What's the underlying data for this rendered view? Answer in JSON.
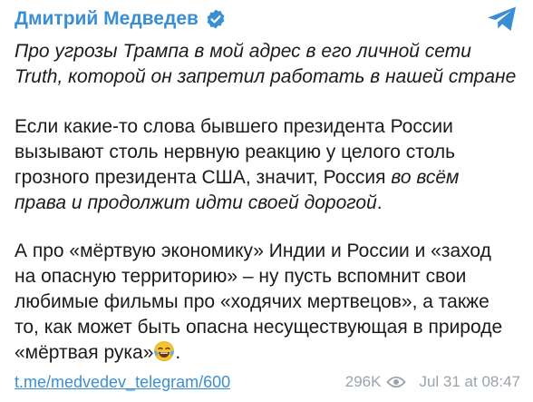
{
  "channel": {
    "name": "Дмитрий Медведев",
    "verified_icon": "verified-badge-icon",
    "app_logo_icon": "telegram-plane-icon"
  },
  "post": {
    "intro_italic": "Про угрозы Трампа в мой адрес в его личной сети Truth, которой он запретил работать в нашей стране",
    "para2_line1": "Если какие-то слова бывшего президента России",
    "para2_line2": "вызывают столь нервную реакцию у целого столь",
    "para2_line3_plain": "грозного президента США, значит, Россия ",
    "para2_line3_italic": "во всём",
    "para2_line4_italic": "права и продолжит идти своей дорогой",
    "para2_line4_end": ".",
    "para3_line1": "А про «мёртвую экономику» Индии и России и «заход",
    "para3_line2": "на опасную территорию» – ну пусть вспомнит свои",
    "para3_line3": "любимые фильмы про «ходячих мертвецов», а также",
    "para3_line4": "то, как может быть опасна несуществующая в природе",
    "para3_line5": "«мёртвая рука»",
    "para3_end": ".",
    "emoji_icon": "tears-of-joy-emoji-icon"
  },
  "footer": {
    "link": "t.me/medvedev_telegram/600",
    "views": "296K",
    "views_icon": "eye-icon",
    "timestamp": "Jul 31 at 08:47"
  },
  "colors": {
    "accent": "#3a8fd4",
    "text": "#1b1b1b",
    "meta": "#9aa3ab",
    "background": "#ffffff"
  }
}
